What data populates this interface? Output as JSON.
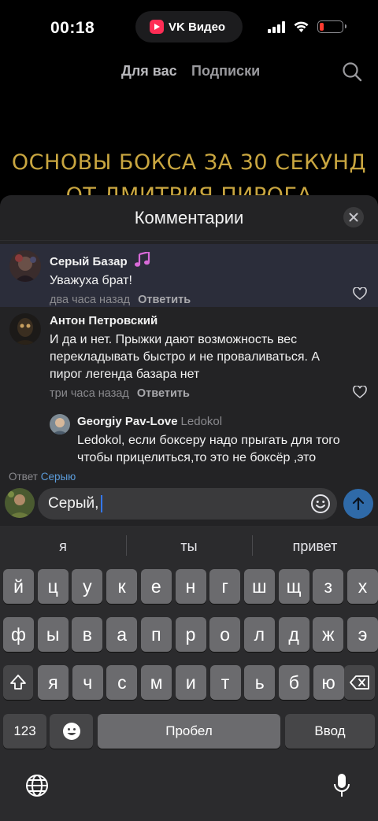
{
  "status_bar": {
    "time": "00:18",
    "app_pill": "VK Видео",
    "icons": [
      "cellular-signal-icon",
      "wifi-icon",
      "battery-low-icon"
    ],
    "battery_level": 0.2,
    "battery_color": "#ff3b30"
  },
  "nav": {
    "tabs": [
      "Для вас",
      "Подписки"
    ],
    "search_icon": "search-icon"
  },
  "video": {
    "title_line1": "ОСНОВЫ БОКСА ЗА 30 СЕКУНД",
    "title_line2": "ОТ ДМИТРИЯ ПИРОГА",
    "title_color": "#c9a640"
  },
  "comments_sheet": {
    "title": "Комментарии",
    "comments": [
      {
        "author": "Серый Базар",
        "author_icon": "music-note-icon",
        "text": "Уважуха брат!",
        "time": "два часа назад",
        "reply_label": "Ответить",
        "highlighted": true
      },
      {
        "author": "Антон Петровский",
        "text": "И да и нет. Прыжки дают возможность вес перекладывать быстро и не проваливаться. А пирог легенда базара нет",
        "time": "три часа назад",
        "reply_label": "Ответить"
      },
      {
        "author": "Georgiy Pav-Love",
        "reply_to": "Ledokol",
        "text": "Ledokol, если боксеру надо прыгать для того чтобы прицелиться,то это не боксёр ,это"
      }
    ],
    "replying_prefix": "Ответ",
    "replying_name": "Серыю",
    "input_value": "Серый,",
    "accent": "#5b9bd9"
  },
  "keyboard": {
    "suggestions": [
      "я",
      "ты",
      "привет"
    ],
    "row1": [
      "й",
      "ц",
      "у",
      "к",
      "е",
      "н",
      "г",
      "ш",
      "щ",
      "з",
      "х"
    ],
    "row2": [
      "ф",
      "ы",
      "в",
      "а",
      "п",
      "р",
      "о",
      "л",
      "д",
      "ж",
      "э"
    ],
    "row3": [
      "я",
      "ч",
      "с",
      "м",
      "и",
      "т",
      "ь",
      "б",
      "ю"
    ],
    "numbers_key": "123",
    "space_key": "Пробел",
    "return_key": "Ввод"
  }
}
